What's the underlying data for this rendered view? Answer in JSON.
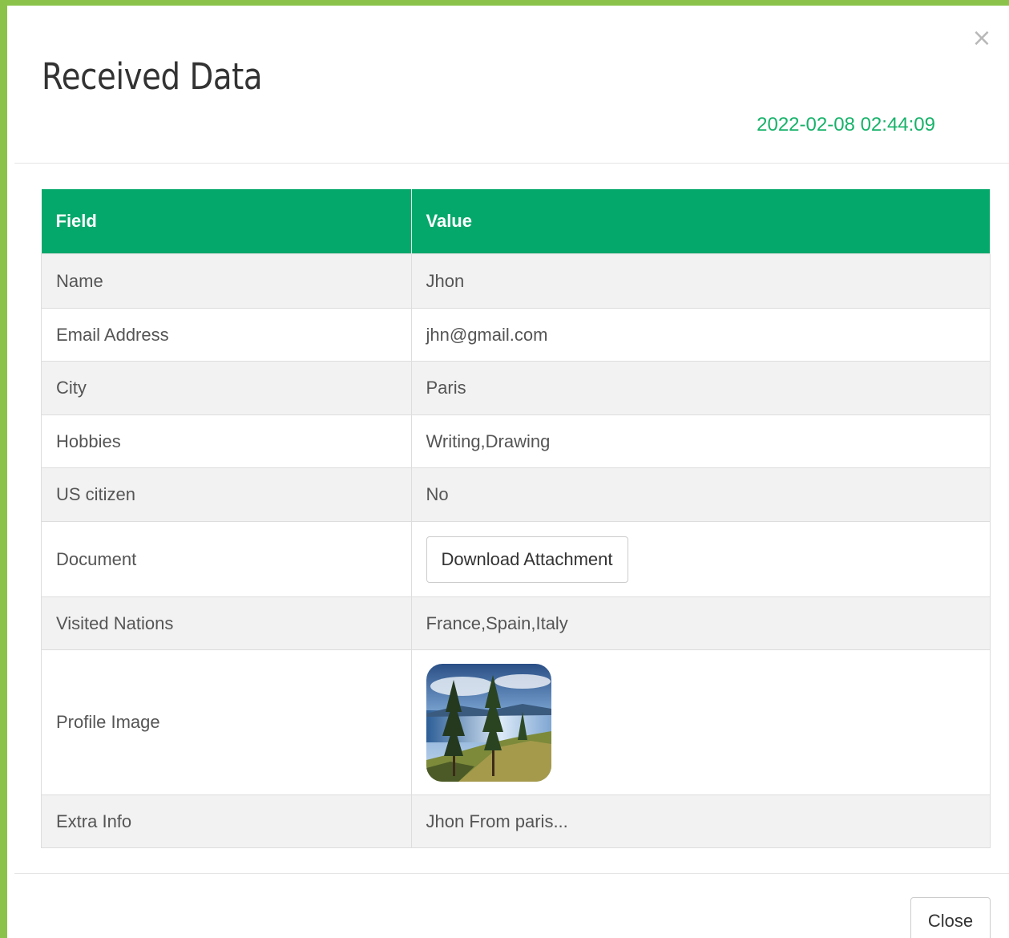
{
  "modal": {
    "title": "Received Data",
    "timestamp": "2022-02-08 02:44:09",
    "close_icon": "×",
    "close_label": "Close"
  },
  "table": {
    "headers": [
      "Field",
      "Value"
    ],
    "rows": [
      {
        "field": "Name",
        "value": "Jhon"
      },
      {
        "field": "Email Address",
        "value": "jhn@gmail.com"
      },
      {
        "field": "City",
        "value": "Paris"
      },
      {
        "field": "Hobbies",
        "value": "Writing,Drawing"
      },
      {
        "field": "US citizen",
        "value": "No"
      },
      {
        "field": "Document",
        "button_label": "Download Attachment"
      },
      {
        "field": "Visited Nations",
        "value": "France,Spain,Italy"
      },
      {
        "field": "Profile Image",
        "image": "landscape-photo"
      },
      {
        "field": "Extra Info",
        "value": "Jhon From paris..."
      }
    ]
  },
  "colors": {
    "border_accent": "#8BC34A",
    "header_bg": "#05a86b",
    "timestamp": "#17b26a"
  }
}
